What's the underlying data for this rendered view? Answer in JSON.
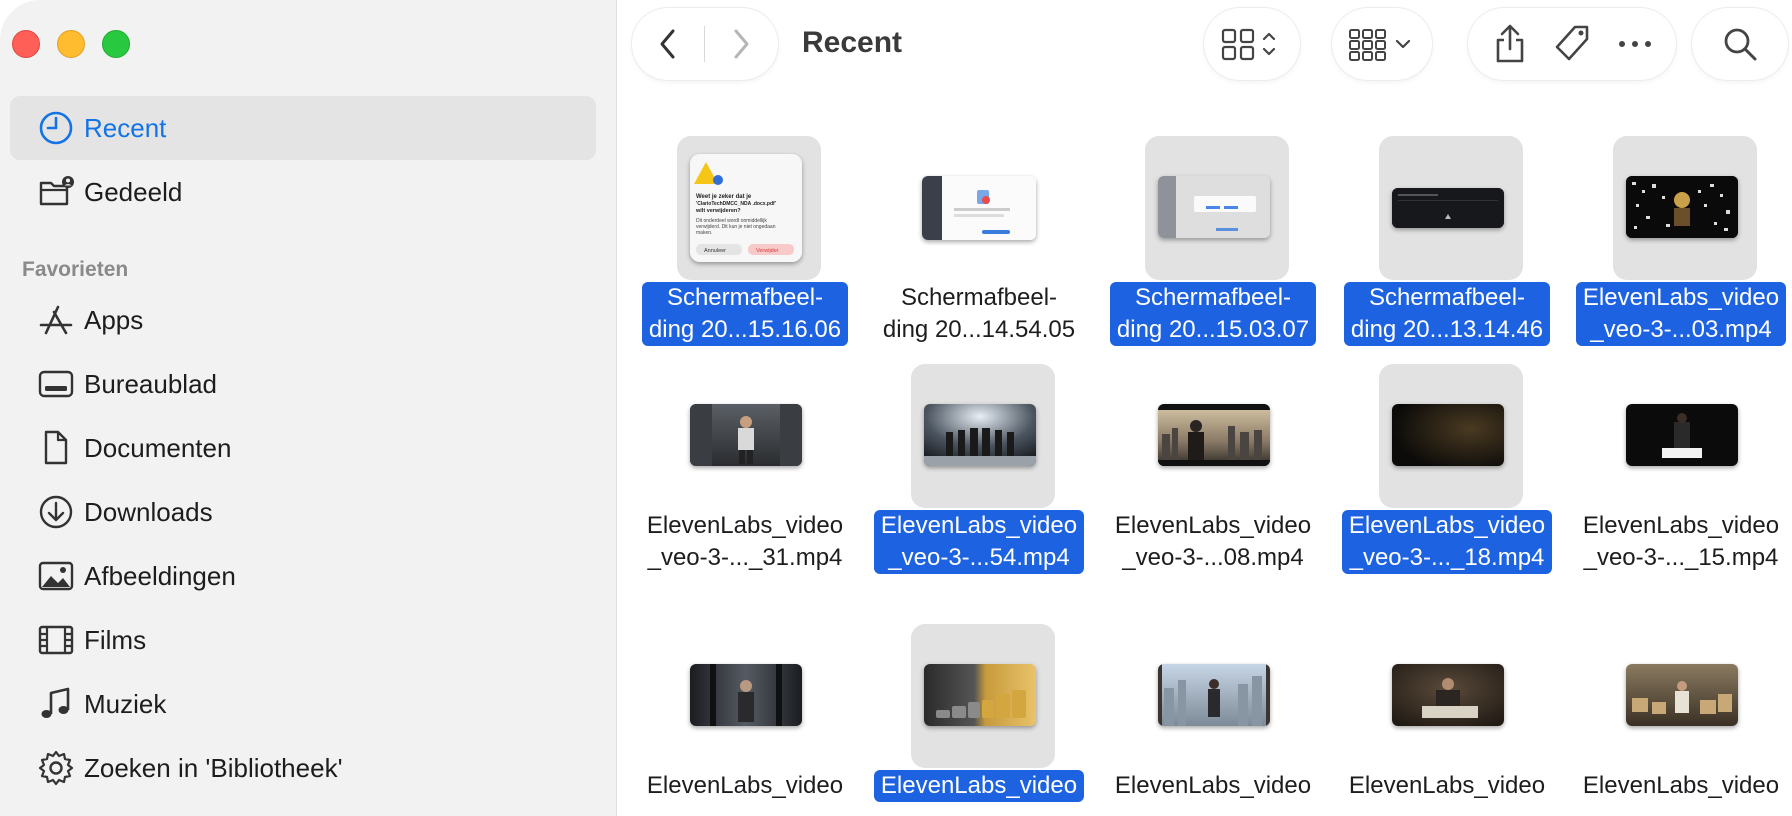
{
  "window": {
    "title": "Recent"
  },
  "sidebar": {
    "items": [
      {
        "label": "Recent",
        "icon": "clock-icon",
        "active": true
      },
      {
        "label": "Gedeeld",
        "icon": "shared-folder-icon"
      }
    ],
    "favorites_title": "Favorieten",
    "favorites": [
      {
        "label": "Apps",
        "icon": "apps-icon"
      },
      {
        "label": "Bureaublad",
        "icon": "desktop-icon"
      },
      {
        "label": "Documenten",
        "icon": "document-icon"
      },
      {
        "label": "Downloads",
        "icon": "download-icon"
      },
      {
        "label": "Afbeeldingen",
        "icon": "image-icon"
      },
      {
        "label": "Films",
        "icon": "film-icon"
      },
      {
        "label": "Muziek",
        "icon": "music-icon"
      },
      {
        "label": "Zoeken in 'Bibliotheek'",
        "icon": "gear-icon"
      }
    ]
  },
  "toolbar": {
    "back_icon": "chevron-left-icon",
    "forward_icon": "chevron-right-icon",
    "view_icon": "grid-view-icon",
    "group_icon": "group-by-icon",
    "share_icon": "share-icon",
    "tag_icon": "tag-icon",
    "more_icon": "ellipsis-icon",
    "search_icon": "search-icon"
  },
  "files": [
    {
      "line1": "Schermafbeel-",
      "line2": "ding 20...15.16.06",
      "selected": true,
      "kind": "dialog-screenshot"
    },
    {
      "line1": "Schermafbeel-",
      "line2": "ding 20...14.54.05",
      "selected": false,
      "kind": "app-screenshot"
    },
    {
      "line1": "Schermafbeel-",
      "line2": "ding 20...15.03.07",
      "selected": true,
      "kind": "app-screenshot-2"
    },
    {
      "line1": "Schermafbeel-",
      "line2": "ding 20...13.14.46",
      "selected": true,
      "kind": "dark-screenshot"
    },
    {
      "line1": "ElevenLabs_video",
      "line2": "_veo-3-...03.mp4",
      "selected": true,
      "kind": "video-code"
    },
    {
      "line1": "ElevenLabs_video",
      "line2": "_veo-3-..._31.mp4",
      "selected": false,
      "kind": "video-street"
    },
    {
      "line1": "ElevenLabs_video",
      "line2": "_veo-3-...54.mp4",
      "selected": true,
      "kind": "video-group"
    },
    {
      "line1": "ElevenLabs_video",
      "line2": "_veo-3-...08.mp4",
      "selected": false,
      "kind": "video-city"
    },
    {
      "line1": "ElevenLabs_video",
      "line2": "_veo-3-..._18.mp4",
      "selected": true,
      "kind": "video-dark"
    },
    {
      "line1": "ElevenLabs_video",
      "line2": "_veo-3-..._15.mp4",
      "selected": false,
      "kind": "video-table"
    },
    {
      "line1": "ElevenLabs_video",
      "line2": "",
      "selected": false,
      "kind": "video-corridor"
    },
    {
      "line1": "ElevenLabs_video",
      "line2": "",
      "selected": true,
      "kind": "video-coins"
    },
    {
      "line1": "ElevenLabs_video",
      "line2": "",
      "selected": false,
      "kind": "video-office"
    },
    {
      "line1": "ElevenLabs_video",
      "line2": "",
      "selected": false,
      "kind": "video-desk"
    },
    {
      "line1": "ElevenLabs_video",
      "line2": "",
      "selected": false,
      "kind": "video-warehouse"
    }
  ],
  "dialog_thumb": {
    "title": "Weet je zeker dat je 'ClarioTechDMCC_NDA .docx.pdf' wilt verwijderen?",
    "body": "Dit onderdeel wordt onmiddellijk verwijderd. Dit kun je niet ongedaan maken.",
    "cancel": "Annuleer",
    "confirm": "Verwijder"
  },
  "colors": {
    "accent": "#1473e6",
    "selection": "#1c62e1",
    "sidebar_bg": "#f2f2f2"
  }
}
